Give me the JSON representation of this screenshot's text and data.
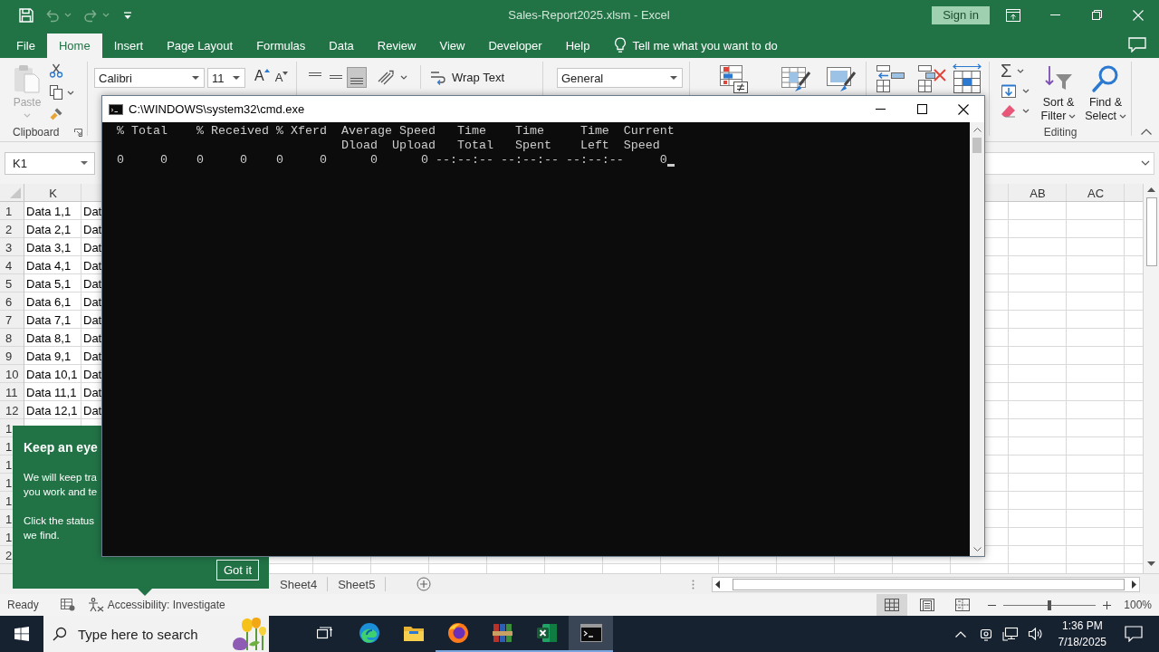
{
  "excel": {
    "title_bar": {
      "quick_access": [
        {
          "kind": "save",
          "disabled": false
        },
        {
          "kind": "undo",
          "disabled": true
        },
        {
          "kind": "redo",
          "disabled": true
        }
      ],
      "title": "Sales-Report2025.xlsm - Excel",
      "sign_in": "Sign in"
    },
    "tabs": [
      {
        "label": "File",
        "selected": false
      },
      {
        "label": "Home",
        "selected": true
      },
      {
        "label": "Insert",
        "selected": false
      },
      {
        "label": "Page Layout",
        "selected": false
      },
      {
        "label": "Formulas",
        "selected": false
      },
      {
        "label": "Data",
        "selected": false
      },
      {
        "label": "Review",
        "selected": false
      },
      {
        "label": "View",
        "selected": false
      },
      {
        "label": "Developer",
        "selected": false
      },
      {
        "label": "Help",
        "selected": false
      }
    ],
    "tell_me": {
      "placeholder": "Tell me what you want to do"
    },
    "ribbon": {
      "clipboard": {
        "paste": {
          "label": "Paste",
          "disabled": true
        },
        "group_label": "Clipboard"
      },
      "font": {
        "family": "Calibri",
        "size": "11",
        "size_buttons": [
          "A",
          "A"
        ]
      },
      "alignment": {
        "buttons": [
          {
            "kind": "top",
            "selected": false
          },
          {
            "kind": "middle",
            "selected": false
          },
          {
            "kind": "bottom",
            "selected": true
          }
        ],
        "wrap_text": "Wrap Text"
      },
      "number": {
        "format": "General"
      },
      "editing": {
        "autosum": "Σ",
        "sort_filter": "Sort & Filter",
        "find_select": "Find & Select",
        "group_label": "Editing"
      }
    },
    "name_box": {
      "value": "K1"
    },
    "column_headers": {
      "left": [
        "K"
      ],
      "right": [
        "AB",
        "AC"
      ]
    },
    "rows": [
      {
        "header": "1",
        "cells": [
          "Data 1,1",
          "Dat"
        ]
      },
      {
        "header": "2",
        "cells": [
          "Data 2,1",
          "Dat"
        ]
      },
      {
        "header": "3",
        "cells": [
          "Data 3,1",
          "Dat"
        ]
      },
      {
        "header": "4",
        "cells": [
          "Data 4,1",
          "Dat"
        ]
      },
      {
        "header": "5",
        "cells": [
          "Data 5,1",
          "Dat"
        ]
      },
      {
        "header": "6",
        "cells": [
          "Data 6,1",
          "Dat"
        ]
      },
      {
        "header": "7",
        "cells": [
          "Data 7,1",
          "Dat"
        ]
      },
      {
        "header": "8",
        "cells": [
          "Data 8,1",
          "Dat"
        ]
      },
      {
        "header": "9",
        "cells": [
          "Data 9,1",
          "Dat"
        ]
      },
      {
        "header": "10",
        "cells": [
          "Data 10,1",
          "Dat"
        ]
      },
      {
        "header": "11",
        "cells": [
          "Data 11,1",
          "Dat"
        ]
      },
      {
        "header": "12",
        "cells": [
          "Data 12,1",
          "Dat"
        ]
      },
      {
        "header": "1"
      },
      {
        "header": "1"
      },
      {
        "header": "1"
      },
      {
        "header": "1"
      },
      {
        "header": "1"
      },
      {
        "header": "1"
      },
      {
        "header": "1"
      },
      {
        "header": "2"
      }
    ],
    "sheet_tabs": [
      {
        "label": "Sheet4",
        "selected": false
      },
      {
        "label": "Sheet5",
        "selected": false
      }
    ],
    "status_bar": {
      "status": "Ready",
      "accessibility": "Accessibility: Investigate",
      "views": [
        {
          "kind": "normal",
          "selected": true
        },
        {
          "kind": "page_layout",
          "selected": false
        },
        {
          "kind": "page_break",
          "selected": false
        }
      ],
      "zoom": {
        "level": 0.5,
        "reading": "100%"
      }
    },
    "callout": {
      "title": "Keep an eye",
      "paragraphs": [
        [
          "We will keep tra",
          "you work and te"
        ],
        [
          "Click the status",
          "we find."
        ]
      ],
      "button": "Got it"
    }
  },
  "console_window": {
    "title": "C:\\WINDOWS\\system32\\cmd.exe",
    "lines": [
      "  % Total    % Received % Xferd  Average Speed   Time    Time     Time  Current",
      "                                 Dload  Upload   Total   Spent    Left  Speed",
      "  0     0    0     0    0     0      0      0 --:--:-- --:--:-- --:--:--     0"
    ]
  },
  "taskbar": {
    "search": {
      "placeholder": "Type here to search"
    },
    "apps": [
      {
        "kind": "edge",
        "open": false,
        "selected": false
      },
      {
        "kind": "explorer",
        "open": false,
        "selected": false
      },
      {
        "kind": "firefox",
        "open": true,
        "selected": false
      },
      {
        "kind": "winrar",
        "open": true,
        "selected": false
      },
      {
        "kind": "excel",
        "open": true,
        "selected": false
      },
      {
        "kind": "terminal",
        "open": true,
        "selected": true
      }
    ],
    "clock": {
      "time": "1:36 PM",
      "date": "7/18/2025"
    }
  }
}
